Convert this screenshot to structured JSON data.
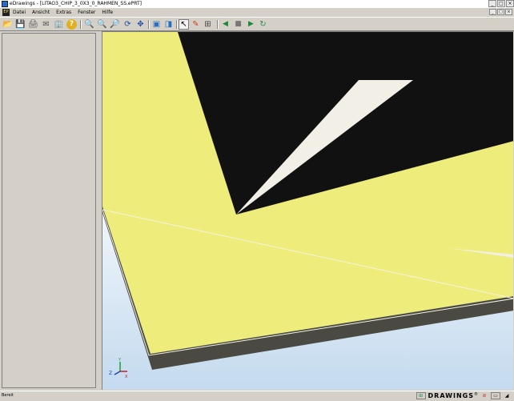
{
  "window": {
    "title": "eDrawings - [LITAO3_CHIP_3_0X3_0_RAHMEN_SS.ePRT]",
    "min_glyph": "_",
    "max_glyph": "□",
    "close_glyph": "×"
  },
  "menubar": {
    "doc_icon_text": "EP",
    "items": [
      {
        "label": "Datei"
      },
      {
        "label": "Ansicht"
      },
      {
        "label": "Extras"
      },
      {
        "label": "Fenster"
      },
      {
        "label": "Hilfe"
      }
    ]
  },
  "toolbar": {
    "buttons": [
      {
        "name": "open-icon",
        "glyph": "📂"
      },
      {
        "name": "save-icon",
        "glyph": "💾"
      },
      {
        "name": "print-icon",
        "glyph": "🖨"
      },
      {
        "name": "send-icon",
        "glyph": "✉"
      },
      {
        "name": "publish-icon",
        "glyph": "🏢"
      },
      {
        "name": "help-icon",
        "glyph": "?"
      },
      {
        "name": "zoom-fit-icon",
        "glyph": "🔍"
      },
      {
        "name": "zoom-in-icon",
        "glyph": "🔍"
      },
      {
        "name": "zoom-area-icon",
        "glyph": "🔎"
      },
      {
        "name": "rotate-icon",
        "glyph": "⟳"
      },
      {
        "name": "pan-icon",
        "glyph": "✥"
      },
      {
        "name": "shaded-icon",
        "glyph": "▣"
      },
      {
        "name": "perspective-icon",
        "glyph": "◨"
      },
      {
        "name": "select-icon",
        "glyph": "↖"
      },
      {
        "name": "markup-icon",
        "glyph": "✎"
      },
      {
        "name": "measure-icon",
        "glyph": "⊞"
      },
      {
        "name": "play-previous-icon",
        "glyph": "◀"
      },
      {
        "name": "stop-icon",
        "glyph": "■"
      },
      {
        "name": "play-next-icon",
        "glyph": "▶"
      },
      {
        "name": "animate-icon",
        "glyph": "↻"
      }
    ]
  },
  "status": {
    "text": "Bereit",
    "brand": "DRAWINGS",
    "brand_mark": "®"
  },
  "triad": {
    "x_label": "X",
    "y_label": "Y",
    "z_label": "Z"
  },
  "colors": {
    "background": "#d4d0c8",
    "yellow_face": "#eeec7a",
    "black_face": "#111111",
    "sliver": "#f2f0e6",
    "edge": "#4a4a42",
    "sky_top": "#ffffff",
    "sky_bottom": "#cfe2f3"
  }
}
